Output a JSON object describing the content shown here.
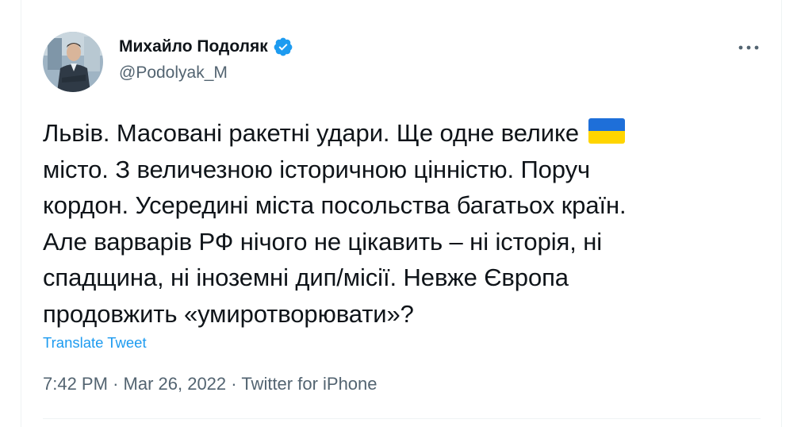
{
  "author": {
    "display_name": "Михайло Подоляк",
    "handle": "@Podolyak_M",
    "verified": true,
    "avatar_icon": "profile-photo"
  },
  "tweet": {
    "lines": [
      "Львів. Масовані ракетні удари. Ще одне велике",
      "місто. З величезною історичною цінністю. Поруч",
      "кордон. Усередині міста посольства багатьох країн.",
      "Але варварів РФ нічого не цікавить – ні історія, ні",
      "спадщина, ні іноземні дип/місії. Невже Європа",
      "продовжить «умиротворювати»?"
    ],
    "emoji": "ukraine-flag-emoji",
    "translate_label": "Translate Tweet",
    "time": "7:42 PM",
    "date": "Mar 26, 2022",
    "source": "Twitter for iPhone",
    "separator": "·"
  },
  "colors": {
    "accent": "#1d9bf0",
    "text": "#0f1419",
    "muted": "#536471",
    "flag_blue": "#1e6fd9",
    "flag_yellow": "#ffd500"
  }
}
